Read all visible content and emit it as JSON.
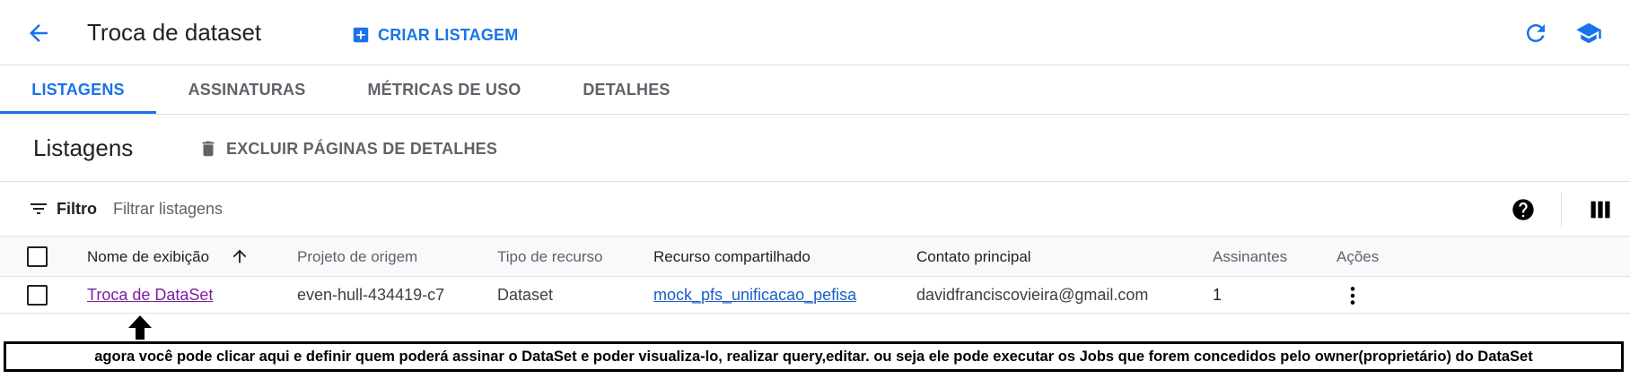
{
  "header": {
    "title": "Troca de dataset",
    "create_label": "CRIAR LISTAGEM",
    "icons": [
      "arrow-back-icon",
      "add-box-icon",
      "refresh-icon",
      "school-icon"
    ]
  },
  "tabs": [
    {
      "label": "LISTAGENS",
      "active": true
    },
    {
      "label": "ASSINATURAS",
      "active": false
    },
    {
      "label": "MÉTRICAS DE USO",
      "active": false
    },
    {
      "label": "DETALHES",
      "active": false
    }
  ],
  "section": {
    "title": "Listagens",
    "delete_label": "EXCLUIR PÁGINAS DE DETALHES"
  },
  "filter": {
    "label": "Filtro",
    "placeholder": "Filtrar listagens"
  },
  "table": {
    "columns": [
      "Nome de exibição",
      "Projeto de origem",
      "Tipo de recurso",
      "Recurso compartilhado",
      "Contato principal",
      "Assinantes",
      "Ações"
    ],
    "sort_column": "Nome de exibição",
    "sort_direction": "ascending",
    "rows": [
      {
        "name": "Troca de DataSet",
        "project": "even-hull-434419-c7",
        "resource_type": "Dataset",
        "shared_resource": "mock_pfs_unificacao_pefisa",
        "contact": "davidfranciscovieira@gmail.com",
        "subscribers": "1"
      }
    ]
  },
  "annotation": {
    "text": "agora você pode clicar aqui e definir quem poderá assinar o DataSet e poder visualiza-lo, realizar query,editar. ou seja ele pode executar os Jobs que forem concedidos pelo owner(proprietário) do DataSet"
  },
  "colors": {
    "accent": "#1a73e8",
    "visited_link": "#7b1fa2",
    "muted_text": "#5f6368"
  }
}
